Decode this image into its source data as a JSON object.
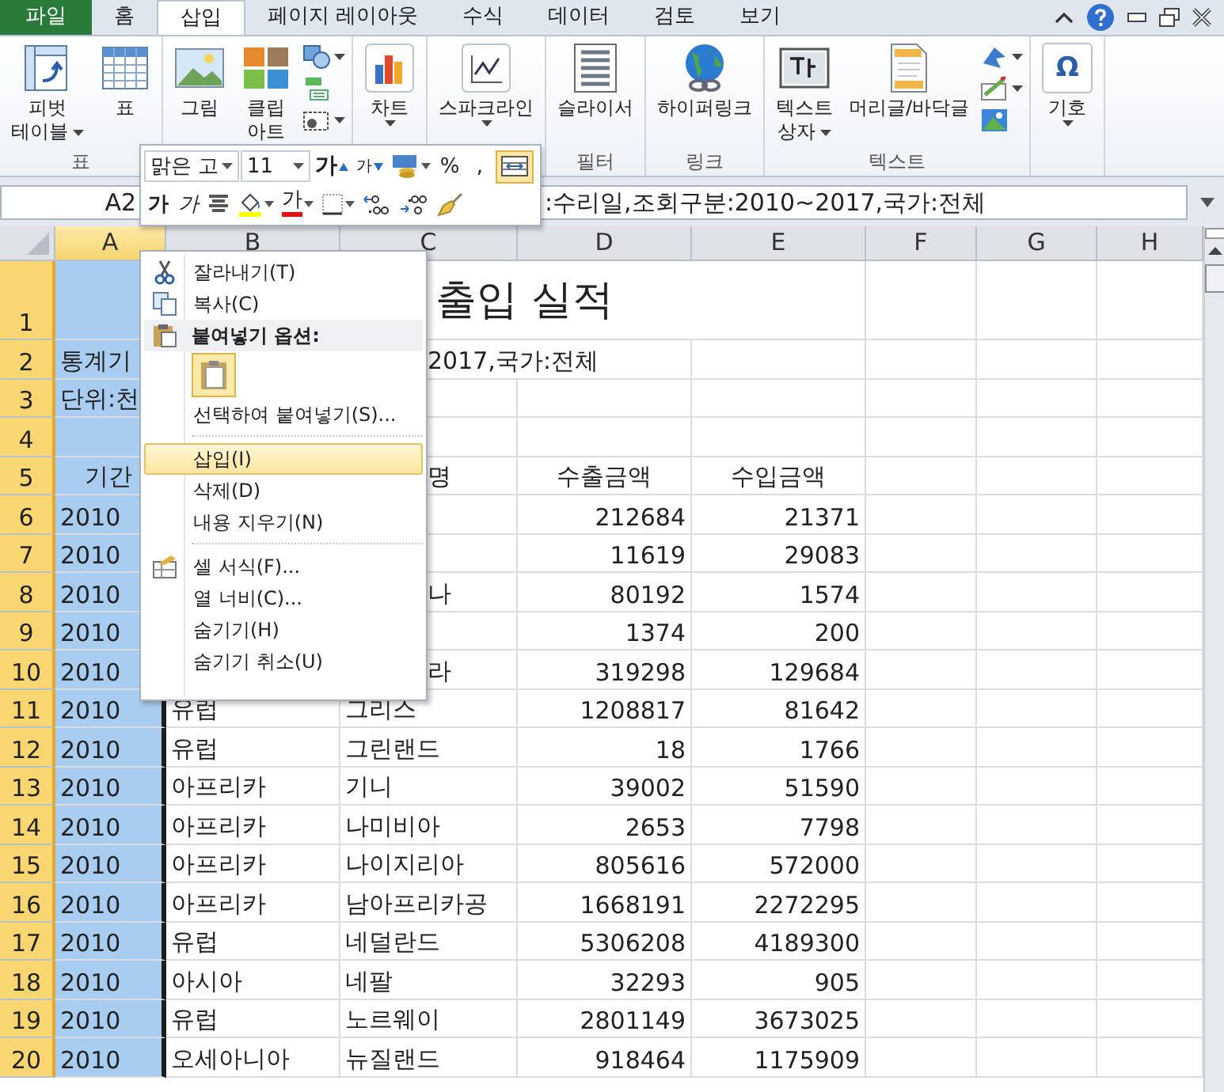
{
  "ribbon_tabs": [
    {
      "label": "파일",
      "kind": "file",
      "selected": false
    },
    {
      "label": "홈",
      "kind": "tab",
      "selected": false
    },
    {
      "label": "삽입",
      "kind": "tab",
      "selected": true
    },
    {
      "label": "페이지 레이아웃",
      "kind": "tab",
      "selected": false
    },
    {
      "label": "수식",
      "kind": "tab",
      "selected": false
    },
    {
      "label": "데이터",
      "kind": "tab",
      "selected": false
    },
    {
      "label": "검토",
      "kind": "tab",
      "selected": false
    },
    {
      "label": "보기",
      "kind": "tab",
      "selected": false
    }
  ],
  "ribbon": {
    "groups": [
      {
        "label": "표",
        "buttons": [
          {
            "kind": "large",
            "lines": [
              "피벗",
              "테이블"
            ],
            "dropdown": true
          },
          {
            "kind": "large",
            "lines": [
              "표"
            ],
            "dropdown": false
          }
        ]
      },
      {
        "buttons": [
          {
            "kind": "large",
            "lines": [
              "그림"
            ],
            "dropdown": false
          },
          {
            "kind": "large",
            "lines": [
              "클립",
              "아트"
            ],
            "dropdown": false
          },
          {
            "kind": "stack",
            "items": [
              {
                "dropdown": true
              },
              {
                "dropdown": false
              },
              {
                "dropdown": true
              }
            ]
          }
        ]
      },
      {
        "buttons": [
          {
            "kind": "large",
            "lines": [
              "차트"
            ],
            "dropdown": true
          }
        ]
      },
      {
        "buttons": [
          {
            "kind": "large",
            "lines": [
              "스파크라인"
            ],
            "dropdown": true
          }
        ]
      },
      {
        "label": "필터",
        "buttons": [
          {
            "kind": "large",
            "lines": [
              "슬라이서"
            ],
            "dropdown": false
          }
        ]
      },
      {
        "label": "링크",
        "buttons": [
          {
            "kind": "large",
            "lines": [
              "하이퍼링크"
            ],
            "dropdown": false
          }
        ]
      },
      {
        "label": "텍스트",
        "buttons": [
          {
            "kind": "large",
            "lines": [
              "텍스트",
              "상자"
            ],
            "dropdown": true
          },
          {
            "kind": "large",
            "lines": [
              "머리글/바닥글"
            ],
            "dropdown": false
          },
          {
            "kind": "stack",
            "items": [
              {
                "dropdown": true
              },
              {
                "dropdown": true
              },
              {
                "dropdown": false
              }
            ]
          }
        ]
      },
      {
        "buttons": [
          {
            "kind": "large",
            "glyph": "Ω",
            "lines": [
              "기호"
            ],
            "dropdown": true
          }
        ]
      }
    ]
  },
  "formula_bar": {
    "name_box": "A2",
    "formula": ":수리일,조회구분:2010~2017,국가:전체"
  },
  "mini_toolbar": {
    "font": "맑은 고",
    "size": "11",
    "row1": [
      {
        "kind": "grow",
        "text": "가",
        "dropdown": false,
        "on": false
      },
      {
        "kind": "shrink",
        "text": "가",
        "dropdown": false,
        "on": false
      },
      {
        "kind": "accounting",
        "dropdown": true,
        "on": false
      },
      {
        "kind": "glyph",
        "text": "%",
        "dropdown": false,
        "on": false
      },
      {
        "kind": "glyph",
        "text": ",",
        "dropdown": false,
        "on": false
      },
      {
        "kind": "merge",
        "dropdown": false,
        "on": true
      }
    ],
    "row2": [
      {
        "kind": "bold",
        "text": "가",
        "dropdown": false,
        "on": false
      },
      {
        "kind": "italic",
        "text": "가",
        "dropdown": false,
        "on": false
      },
      {
        "kind": "center",
        "dropdown": false,
        "on": false
      },
      {
        "kind": "fill",
        "dropdown": true,
        "on": false
      },
      {
        "kind": "fontcolor",
        "text": "가",
        "dropdown": true,
        "on": false
      },
      {
        "kind": "borders",
        "dropdown": true,
        "on": false
      },
      {
        "kind": "incdec",
        "dropdown": false,
        "on": false
      },
      {
        "kind": "decdec",
        "dropdown": false,
        "on": false
      },
      {
        "kind": "painter",
        "dropdown": false,
        "on": false
      }
    ]
  },
  "context_menu": [
    {
      "kind": "command",
      "label": "잘라내기(T)",
      "highlighted": false
    },
    {
      "kind": "command",
      "label": "복사(C)",
      "highlighted": false
    },
    {
      "kind": "header",
      "label": "붙여넣기 옵션:"
    },
    {
      "kind": "paste-options"
    },
    {
      "kind": "command",
      "label": "선택하여 붙여넣기(S)...",
      "highlighted": false
    },
    {
      "kind": "separator"
    },
    {
      "kind": "command",
      "label": "삽입(I)",
      "highlighted": true
    },
    {
      "kind": "command",
      "label": "삭제(D)",
      "highlighted": false
    },
    {
      "kind": "command",
      "label": "내용 지우기(N)",
      "highlighted": false
    },
    {
      "kind": "separator"
    },
    {
      "kind": "command",
      "label": "셀 서식(F)...",
      "highlighted": false
    },
    {
      "kind": "command",
      "label": "열 너비(C)...",
      "highlighted": false
    },
    {
      "kind": "command",
      "label": "숨기기(H)",
      "highlighted": false
    },
    {
      "kind": "command",
      "label": "숨기기 취소(U)",
      "highlighted": false
    }
  ],
  "sheet": {
    "columns": [
      {
        "label": "A",
        "selected": true
      },
      {
        "label": "B",
        "selected": false
      },
      {
        "label": "C",
        "selected": false
      },
      {
        "label": "D",
        "selected": false
      },
      {
        "label": "E",
        "selected": false
      },
      {
        "label": "F",
        "selected": false
      },
      {
        "label": "G",
        "selected": false
      },
      {
        "label": "H",
        "selected": false
      }
    ],
    "rows": [
      {
        "number": "1",
        "kind": "title",
        "text": "출입 실적"
      },
      {
        "number": "2",
        "kind": "note",
        "left": "통계기",
        "right": "2017,국가:전체"
      },
      {
        "number": "3",
        "kind": "note",
        "left": "단위:천"
      },
      {
        "number": "4",
        "kind": "blank"
      },
      {
        "number": "5",
        "kind": "header",
        "period": "기간",
        "country": "명",
        "exports": "수출금액",
        "imports": "수입금액"
      },
      {
        "number": "6",
        "kind": "data",
        "period": "2010",
        "exports": "212684",
        "imports": "21371"
      },
      {
        "number": "7",
        "kind": "data",
        "period": "2010",
        "exports": "11619",
        "imports": "29083"
      },
      {
        "number": "8",
        "kind": "data",
        "period": "2010",
        "country": "나",
        "exports": "80192",
        "imports": "1574"
      },
      {
        "number": "9",
        "kind": "data",
        "period": "2010",
        "exports": "1374",
        "imports": "200"
      },
      {
        "number": "10",
        "kind": "data",
        "period": "2010",
        "country": "라",
        "exports": "319298",
        "imports": "129684"
      },
      {
        "number": "11",
        "kind": "data",
        "period": "2010",
        "region": "유럽",
        "country": "그리스",
        "exports": "1208817",
        "imports": "81642"
      },
      {
        "number": "12",
        "kind": "data",
        "period": "2010",
        "region": "유럽",
        "country": "그린랜드",
        "exports": "18",
        "imports": "1766"
      },
      {
        "number": "13",
        "kind": "data",
        "period": "2010",
        "region": "아프리카",
        "country": "기니",
        "exports": "39002",
        "imports": "51590"
      },
      {
        "number": "14",
        "kind": "data",
        "period": "2010",
        "region": "아프리카",
        "country": "나미비아",
        "exports": "2653",
        "imports": "7798"
      },
      {
        "number": "15",
        "kind": "data",
        "period": "2010",
        "region": "아프리카",
        "country": "나이지리아",
        "exports": "805616",
        "imports": "572000"
      },
      {
        "number": "16",
        "kind": "data",
        "period": "2010",
        "region": "아프리카",
        "country": "남아프리카공",
        "exports": "1668191",
        "imports": "2272295"
      },
      {
        "number": "17",
        "kind": "data",
        "period": "2010",
        "region": "유럽",
        "country": "네덜란드",
        "exports": "5306208",
        "imports": "4189300"
      },
      {
        "number": "18",
        "kind": "data",
        "period": "2010",
        "region": "아시아",
        "country": "네팔",
        "exports": "32293",
        "imports": "905"
      },
      {
        "number": "19",
        "kind": "data",
        "period": "2010",
        "region": "유럽",
        "country": "노르웨이",
        "exports": "2801149",
        "imports": "3673025"
      },
      {
        "number": "20",
        "kind": "data",
        "period": "2010",
        "region": "오세아니아",
        "country": "뉴질랜드",
        "exports": "918464",
        "imports": "1175909"
      }
    ]
  }
}
